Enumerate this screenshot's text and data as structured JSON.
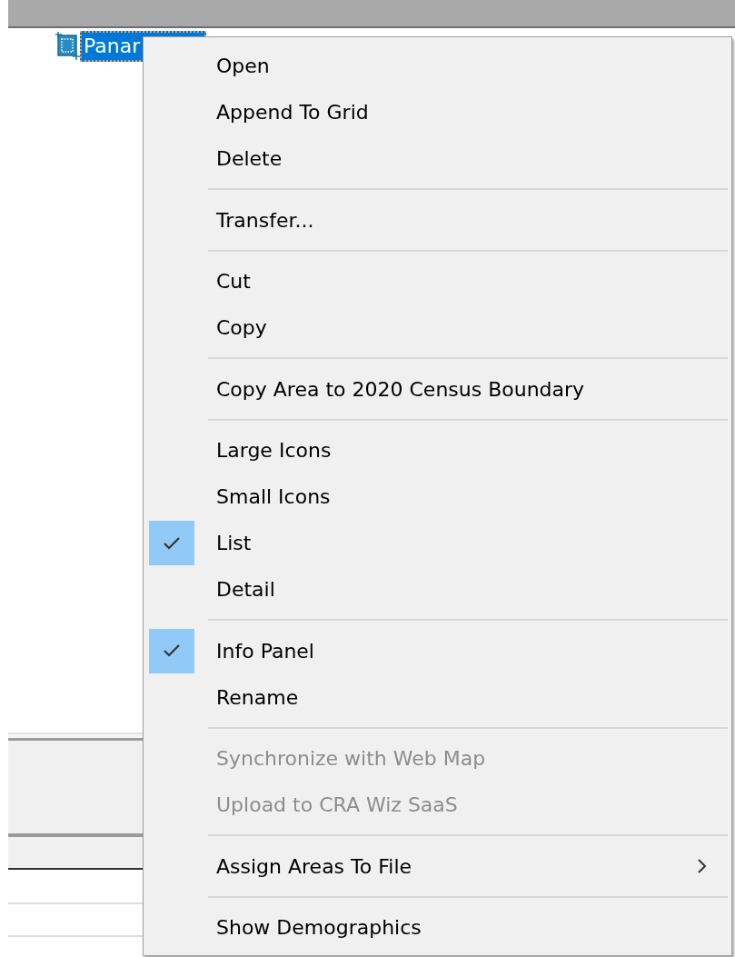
{
  "tree": {
    "items": [
      {
        "label": "Panar",
        "selected": true
      }
    ]
  },
  "context_menu": {
    "items": [
      {
        "kind": "item",
        "label": "Open",
        "checked": false,
        "disabled": false
      },
      {
        "kind": "item",
        "label": "Append To Grid",
        "checked": false,
        "disabled": false
      },
      {
        "kind": "item",
        "label": "Delete",
        "checked": false,
        "disabled": false
      },
      {
        "kind": "separator"
      },
      {
        "kind": "item",
        "label": "Transfer...",
        "checked": false,
        "disabled": false
      },
      {
        "kind": "separator"
      },
      {
        "kind": "item",
        "label": "Cut",
        "checked": false,
        "disabled": false
      },
      {
        "kind": "item",
        "label": "Copy",
        "checked": false,
        "disabled": false
      },
      {
        "kind": "separator"
      },
      {
        "kind": "item",
        "label": "Copy Area to 2020 Census Boundary",
        "checked": false,
        "disabled": false
      },
      {
        "kind": "separator"
      },
      {
        "kind": "item",
        "label": "Large Icons",
        "checked": false,
        "disabled": false
      },
      {
        "kind": "item",
        "label": "Small Icons",
        "checked": false,
        "disabled": false
      },
      {
        "kind": "item",
        "label": "List",
        "checked": true,
        "disabled": false
      },
      {
        "kind": "item",
        "label": "Detail",
        "checked": false,
        "disabled": false
      },
      {
        "kind": "separator"
      },
      {
        "kind": "item",
        "label": "Info Panel",
        "checked": true,
        "disabled": false
      },
      {
        "kind": "item",
        "label": "Rename",
        "checked": false,
        "disabled": false
      },
      {
        "kind": "separator"
      },
      {
        "kind": "item",
        "label": "Synchronize with Web Map",
        "checked": false,
        "disabled": true
      },
      {
        "kind": "item",
        "label": "Upload to CRA Wiz SaaS",
        "checked": false,
        "disabled": true
      },
      {
        "kind": "separator"
      },
      {
        "kind": "submenu",
        "label": "Assign Areas To File",
        "checked": false,
        "disabled": false
      },
      {
        "kind": "separator"
      },
      {
        "kind": "item",
        "label": "Show Demographics",
        "checked": false,
        "disabled": false
      }
    ]
  }
}
